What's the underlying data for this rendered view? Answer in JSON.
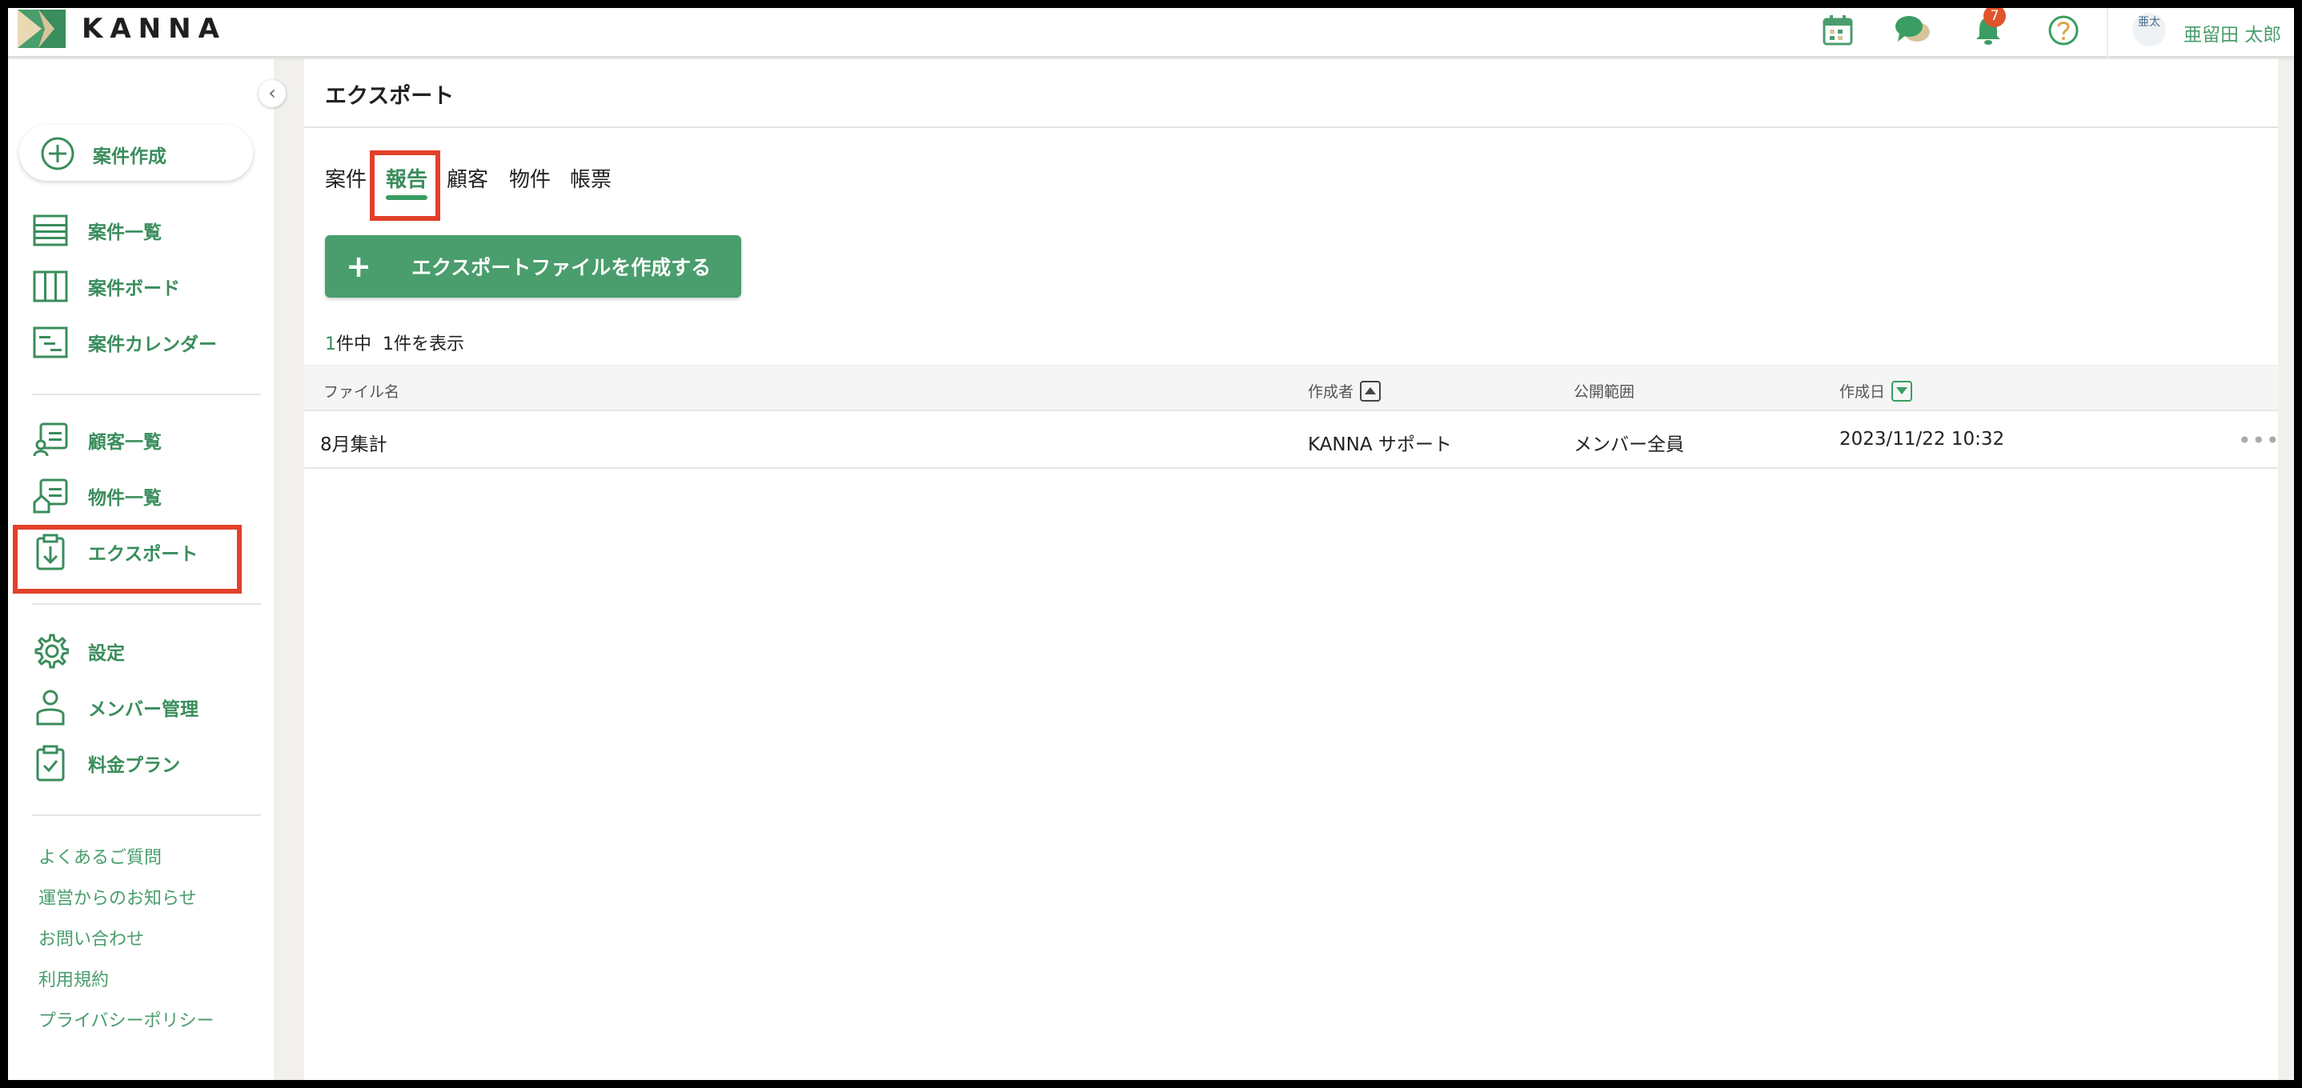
{
  "app": {
    "brand": "KANNA",
    "brand_color": "#4a9d6c",
    "highlight_color": "#e2402b"
  },
  "topbar": {
    "icons": [
      "calendar-icon",
      "chat-icon",
      "bell-icon",
      "help-icon"
    ],
    "notification_count": "7",
    "user_avatar_text": "亜太",
    "user_name": "亜留田 太郎"
  },
  "sidebar": {
    "create_label": "案件作成",
    "groups": [
      [
        {
          "label": "案件一覧",
          "icon": "list-icon"
        },
        {
          "label": "案件ボード",
          "icon": "board-icon"
        },
        {
          "label": "案件カレンダー",
          "icon": "calendar-list-icon"
        }
      ],
      [
        {
          "label": "顧客一覧",
          "icon": "customer-icon"
        },
        {
          "label": "物件一覧",
          "icon": "property-icon"
        },
        {
          "label": "エクスポート",
          "icon": "export-icon"
        }
      ],
      [
        {
          "label": "設定",
          "icon": "gear-icon"
        },
        {
          "label": "メンバー管理",
          "icon": "member-icon"
        },
        {
          "label": "料金プラン",
          "icon": "plan-icon"
        }
      ]
    ],
    "footer_links": [
      "よくあるご質問",
      "運営からのお知らせ",
      "お問い合わせ",
      "利用規約",
      "プライバシーポリシー"
    ]
  },
  "main": {
    "title": "エクスポート",
    "tabs": [
      "案件",
      "報告",
      "顧客",
      "物件",
      "帳票"
    ],
    "active_tab": "報告",
    "export_button_label": "エクスポートファイルを作成する",
    "count_total": "1",
    "count_suffix": "件中",
    "count_shown": "1件を表示",
    "table": {
      "columns": [
        "ファイル名",
        "作成者",
        "公開範囲",
        "作成日"
      ],
      "rows": [
        {
          "file_name": "8月集計",
          "author": "KANNA サポート",
          "scope": "メンバー全員",
          "created": "2023/11/22 10:32"
        }
      ]
    }
  }
}
